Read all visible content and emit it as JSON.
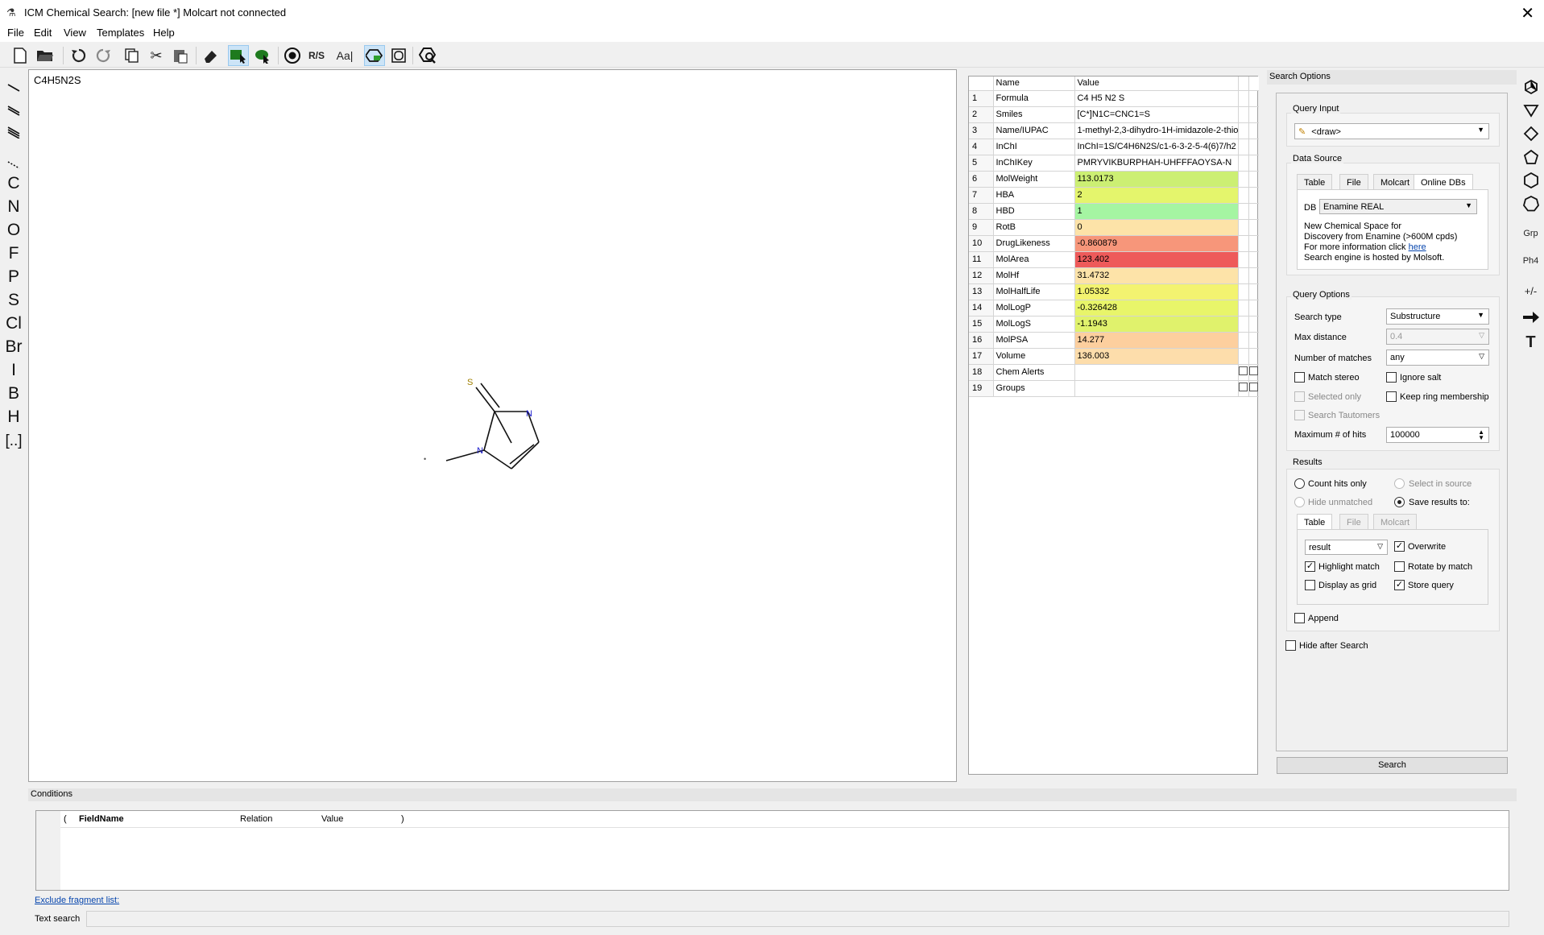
{
  "window": {
    "title": "ICM Chemical Search: [new file *] Molcart not connected",
    "close": "✕"
  },
  "menu": [
    "File",
    "Edit",
    "View",
    "Templates",
    "Help"
  ],
  "toolbar": {
    "rs_label": "R/S",
    "aa_label": "Aa|"
  },
  "palette": {
    "elements": [
      "C",
      "N",
      "O",
      "F",
      "P",
      "S",
      "Cl",
      "Br",
      "I",
      "B",
      "H",
      "[..]"
    ]
  },
  "canvas": {
    "formula": "C4H5N2S",
    "molecule": {
      "atom_s": "S",
      "atom_n1": "N",
      "atom_n2": "N",
      "radical": "•"
    }
  },
  "properties": {
    "headers": {
      "name": "Name",
      "value": "Value"
    },
    "rows": [
      {
        "n": "1",
        "name": "Formula",
        "value": "C4 H5 N2 S",
        "color": "#ffffff"
      },
      {
        "n": "2",
        "name": "Smiles",
        "value": "[C*]N1C=CNC1=S",
        "color": "#ffffff"
      },
      {
        "n": "3",
        "name": "Name/IUPAC",
        "value": "1-methyl-2,3-dihydro-1H-imidazole-2-thio",
        "color": "#ffffff"
      },
      {
        "n": "4",
        "name": "InChI",
        "value": "InChI=1S/C4H6N2S/c1-6-3-2-5-4(6)7/h2",
        "color": "#ffffff"
      },
      {
        "n": "5",
        "name": "InChIKey",
        "value": "PMRYVIKBURPHAH-UHFFFAOYSA-N",
        "color": "#ffffff"
      },
      {
        "n": "6",
        "name": "MolWeight",
        "value": "113.0173",
        "color": "#ccef73"
      },
      {
        "n": "7",
        "name": "HBA",
        "value": "2",
        "color": "#e4f56c"
      },
      {
        "n": "8",
        "name": "HBD",
        "value": "1",
        "color": "#a5f5a2"
      },
      {
        "n": "9",
        "name": "RotB",
        "value": "0",
        "color": "#fde3a8"
      },
      {
        "n": "10",
        "name": "DrugLikeness",
        "value": "-0.860879",
        "color": "#f7967a"
      },
      {
        "n": "11",
        "name": "MolArea",
        "value": "123.402",
        "color": "#ee5a5a"
      },
      {
        "n": "12",
        "name": "MolHf",
        "value": "31.4732",
        "color": "#fde3a8"
      },
      {
        "n": "13",
        "name": "MolHalfLife",
        "value": "1.05332",
        "color": "#f3f370"
      },
      {
        "n": "14",
        "name": "MolLogP",
        "value": "-0.326428",
        "color": "#e8f56a"
      },
      {
        "n": "15",
        "name": "MolLogS",
        "value": "-1.1943",
        "color": "#e0f26c"
      },
      {
        "n": "16",
        "name": "MolPSA",
        "value": "14.277",
        "color": "#fdcf9e"
      },
      {
        "n": "17",
        "name": "Volume",
        "value": "136.003",
        "color": "#fdddab"
      },
      {
        "n": "18",
        "name": "Chem Alerts",
        "value": "",
        "color": "#ffffff"
      },
      {
        "n": "19",
        "name": "Groups",
        "value": "",
        "color": "#ffffff"
      }
    ]
  },
  "search_options": {
    "header": "Search Options",
    "query_input": {
      "label": "Query Input",
      "value": "<draw>"
    },
    "data_source": {
      "label": "Data Source",
      "tabs": [
        "Table",
        "File",
        "Molcart",
        "Online DBs"
      ],
      "db_label": "DB",
      "db_value": "Enamine REAL",
      "desc1": "New Chemical Space for",
      "desc2": "Discovery from Enamine (>600M cpds)",
      "desc3": "For more information click",
      "desc3_link": "here",
      "desc4": "Search engine is hosted by Molsoft."
    },
    "query_options": {
      "label": "Query Options",
      "search_type_label": "Search type",
      "search_type_value": "Substructure",
      "max_distance_label": "Max distance",
      "max_distance_value": "0.4",
      "num_matches_label": "Number of matches",
      "num_matches_value": "any",
      "match_stereo": "Match stereo",
      "ignore_salt": "Ignore salt",
      "selected_only": "Selected only",
      "keep_ring": "Keep ring membership",
      "search_tautomers": "Search Tautomers",
      "max_hits_label": "Maximum # of hits",
      "max_hits_value": "100000"
    },
    "results": {
      "label": "Results",
      "count_hits": "Count hits only",
      "select_in_source": "Select in source",
      "hide_unmatched": "Hide unmatched",
      "save_results": "Save results to:",
      "tabs": [
        "Table",
        "File",
        "Molcart"
      ],
      "table_value": "result",
      "overwrite": "Overwrite",
      "highlight_match": "Highlight match",
      "rotate_by_match": "Rotate by match",
      "display_as_grid": "Display as grid",
      "store_query": "Store query",
      "append": "Append"
    },
    "hide_after_search": "Hide after Search",
    "search_button": "Search"
  },
  "right_strip": {
    "grp": "Grp",
    "ph4": "Ph4",
    "pm": "+/-",
    "t": "T"
  },
  "conditions": {
    "header": "Conditions",
    "columns": {
      "open": "(",
      "field": "FieldName",
      "relation": "Relation",
      "value": "Value",
      "close": ")"
    },
    "exclude_link": "Exclude fragment list:",
    "text_search_label": "Text search"
  }
}
